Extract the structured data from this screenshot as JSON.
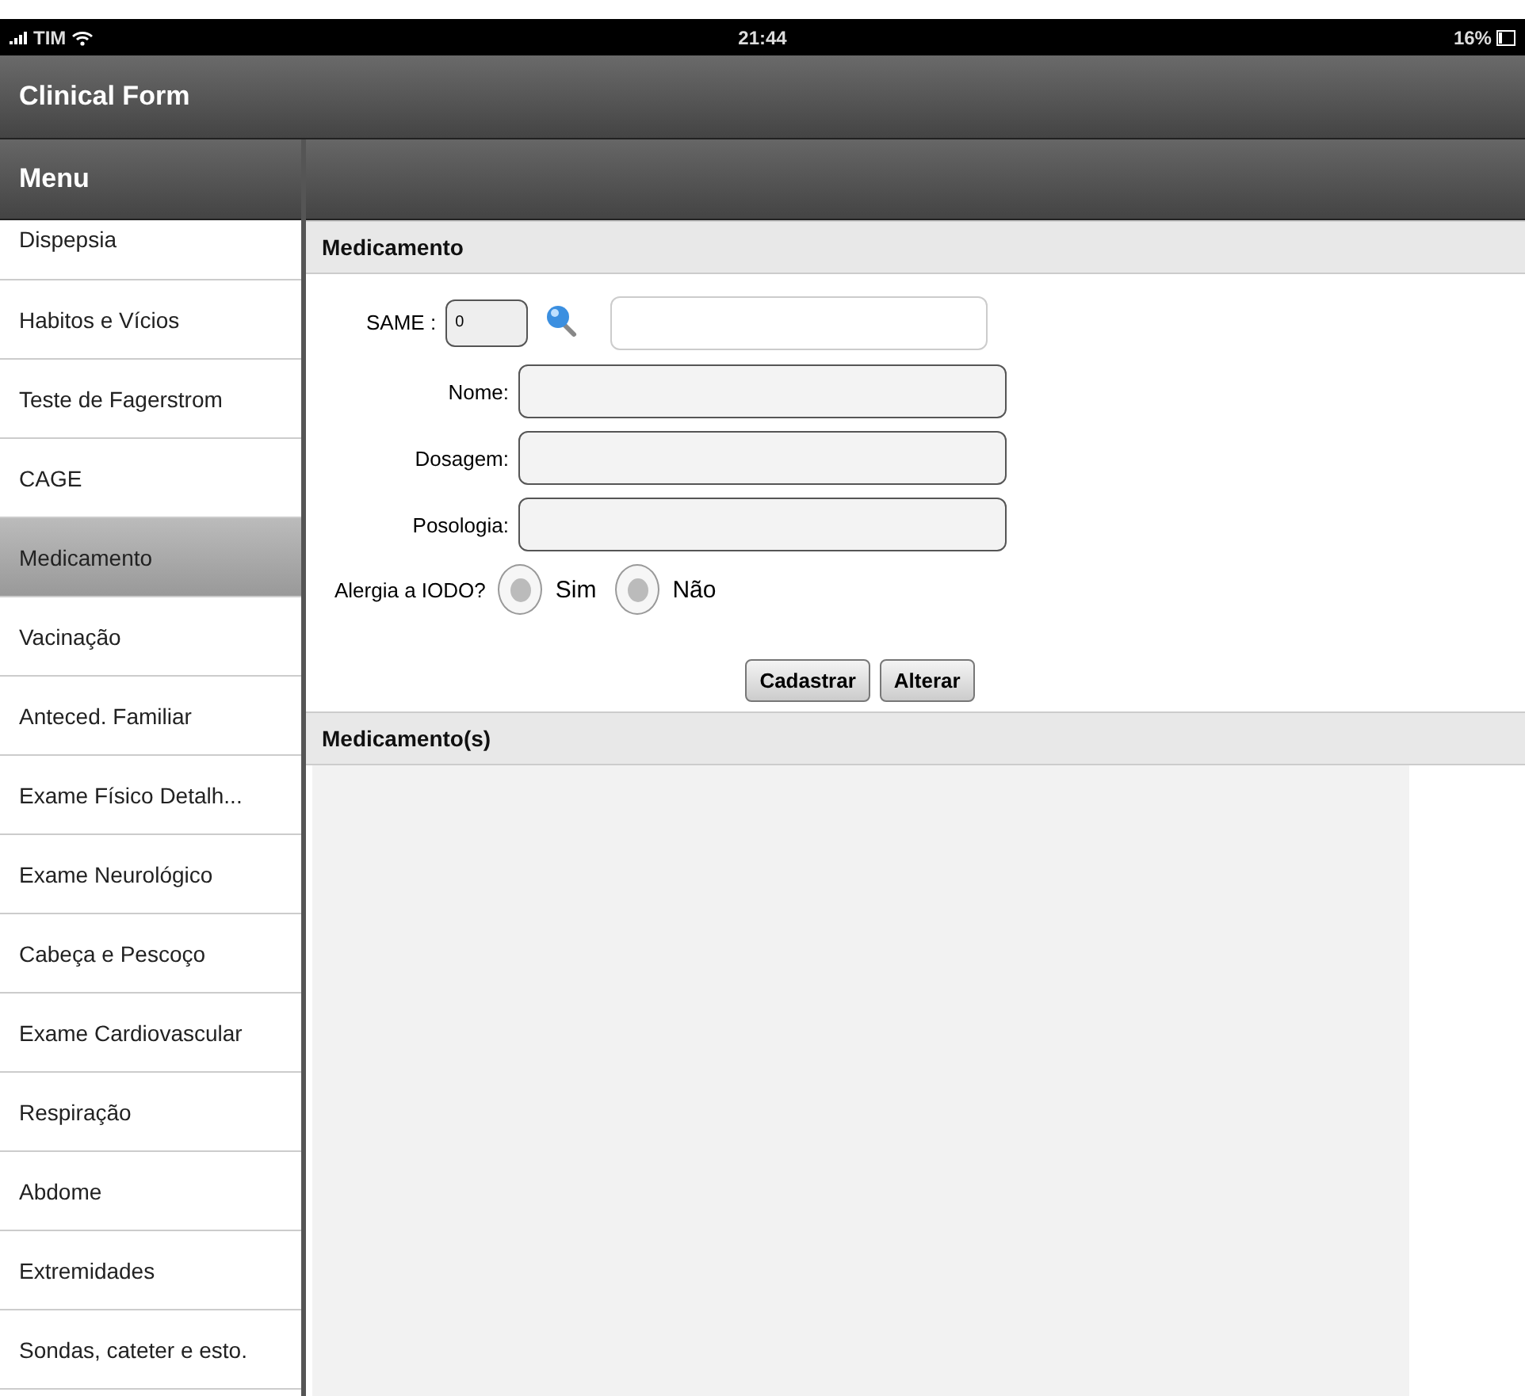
{
  "status_bar": {
    "carrier": "TIM",
    "time": "21:44",
    "battery": "16%"
  },
  "header": {
    "title": "Clinical Form"
  },
  "sidebar": {
    "title": "Menu",
    "items": [
      {
        "label": "Dispepsia",
        "selected": false
      },
      {
        "label": "Habitos e Vícios",
        "selected": false
      },
      {
        "label": "Teste de Fagerstrom",
        "selected": false
      },
      {
        "label": "CAGE",
        "selected": false
      },
      {
        "label": "Medicamento",
        "selected": true
      },
      {
        "label": "Vacinação",
        "selected": false
      },
      {
        "label": "Anteced. Familiar",
        "selected": false
      },
      {
        "label": "Exame Físico Detalh...",
        "selected": false
      },
      {
        "label": "Exame Neurológico",
        "selected": false
      },
      {
        "label": "Cabeça e Pescoço",
        "selected": false
      },
      {
        "label": "Exame Cardiovascular",
        "selected": false
      },
      {
        "label": "Respiração",
        "selected": false
      },
      {
        "label": "Abdome",
        "selected": false
      },
      {
        "label": "Extremidades",
        "selected": false
      },
      {
        "label": "Sondas, cateter e esto.",
        "selected": false
      }
    ]
  },
  "form": {
    "title": "Medicamento",
    "same": {
      "label": "SAME :",
      "value": "0"
    },
    "fields": [
      {
        "label": "Nome:"
      },
      {
        "label": "Dosagem:"
      },
      {
        "label": "Posologia:"
      }
    ],
    "allergy": {
      "label": "Alergia a IODO?",
      "options": [
        {
          "label": "Sim",
          "selected": false
        },
        {
          "label": "Não",
          "selected": false
        }
      ]
    },
    "buttons": [
      "Cadastrar",
      "Alterar"
    ]
  },
  "list": {
    "title": "Medicamento(s)"
  }
}
